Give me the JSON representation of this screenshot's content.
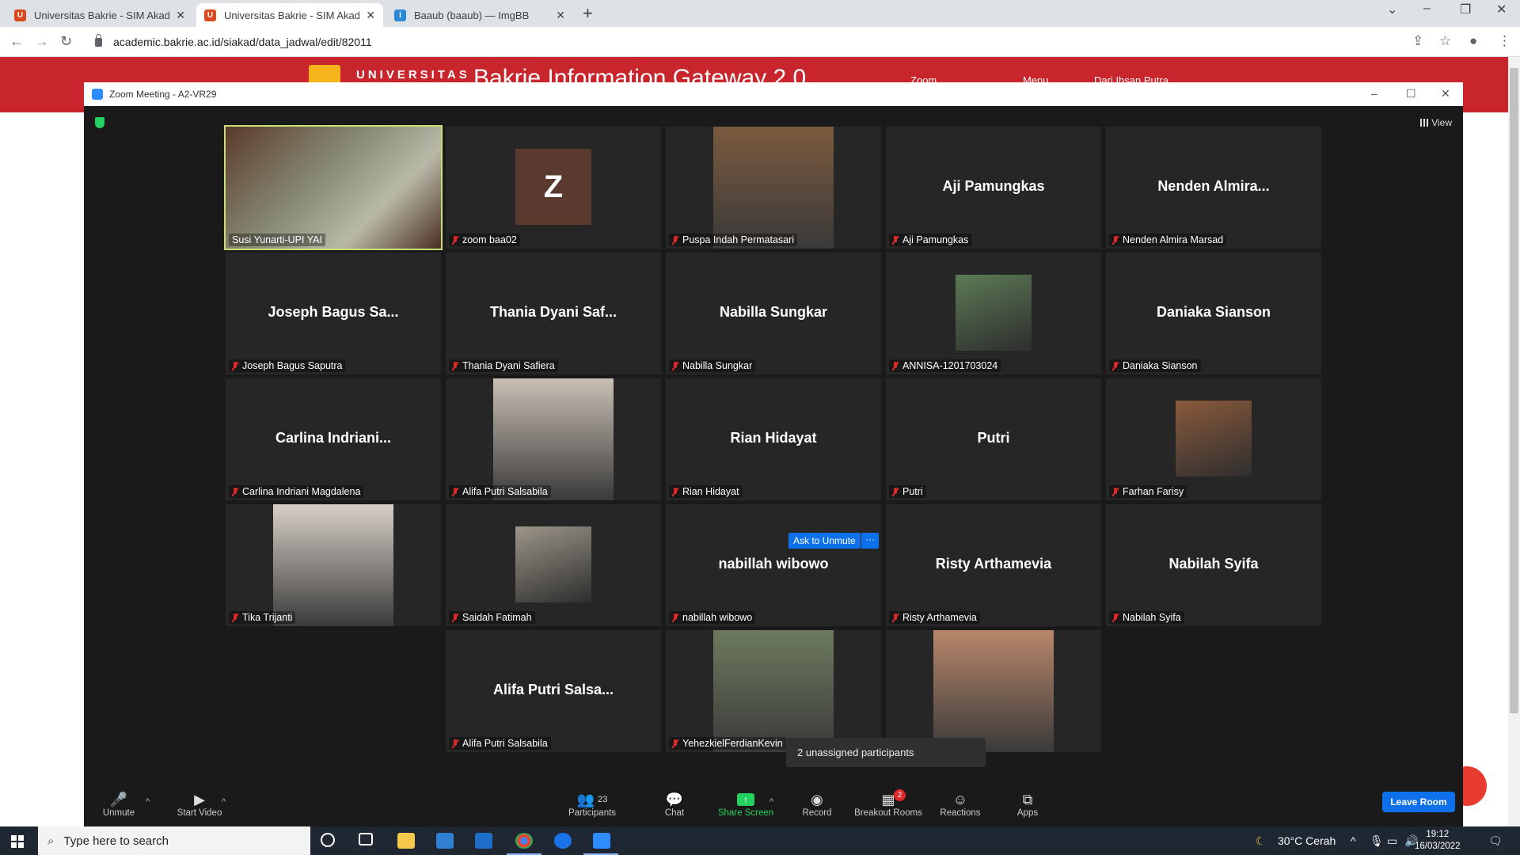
{
  "browser": {
    "tabs": [
      {
        "title": "Universitas Bakrie - SIM Akadem",
        "favicon": "ub"
      },
      {
        "title": "Universitas Bakrie - SIM Akadem",
        "favicon": "ub"
      },
      {
        "title": "Baaub (baaub) — ImgBB",
        "favicon": "ibb"
      }
    ],
    "url": "academic.bakrie.ac.id/siakad/data_jadwal/edit/82011"
  },
  "site": {
    "brand": "UNIVERSITAS",
    "title": "Bakrie Information Gateway 2.0",
    "nav": [
      "Zoom",
      "Menu",
      "Dari Ihsan Putra"
    ]
  },
  "zoom": {
    "window_title": "Zoom Meeting - A2-VR29",
    "view_label": "View",
    "participants": [
      {
        "name": "Susi Yunarti-UPI YAI",
        "display": "",
        "kind": "video",
        "active": true,
        "muted": false,
        "color": "#8a8f7a"
      },
      {
        "name": "zoom baa02",
        "display": "Z",
        "kind": "avatar",
        "muted": true
      },
      {
        "name": "Puspa Indah Permatasari",
        "display": "",
        "kind": "photo",
        "muted": true,
        "color": "#7b5a3d"
      },
      {
        "name": "Aji Pamungkas",
        "display": "Aji Pamungkas",
        "kind": "name",
        "muted": true
      },
      {
        "name": "Nenden Almira Marsad",
        "display": "Nenden Almira...",
        "kind": "name",
        "muted": true
      },
      {
        "name": "Joseph Bagus Saputra",
        "display": "Joseph Bagus Sa...",
        "kind": "name",
        "muted": true
      },
      {
        "name": "Thania Dyani Safiera",
        "display": "Thania Dyani Saf...",
        "kind": "name",
        "muted": true
      },
      {
        "name": "Nabilla Sungkar",
        "display": "Nabilla Sungkar",
        "kind": "name",
        "muted": true
      },
      {
        "name": "ANNISA-1201703024",
        "display": "",
        "kind": "smallphoto",
        "muted": true,
        "color": "#5c7a55"
      },
      {
        "name": "Daniaka Sianson",
        "display": "Daniaka Sianson",
        "kind": "name",
        "muted": true
      },
      {
        "name": "Carlina Indriani Magdalena",
        "display": "Carlina Indriani...",
        "kind": "name",
        "muted": true
      },
      {
        "name": "Alifa Putri Salsabila",
        "display": "",
        "kind": "photo",
        "muted": true,
        "color": "#c9bfb4"
      },
      {
        "name": "Rian Hidayat",
        "display": "Rian Hidayat",
        "kind": "name",
        "muted": true
      },
      {
        "name": "Putri",
        "display": "Putri",
        "kind": "name",
        "muted": true
      },
      {
        "name": "Farhan Farisy",
        "display": "",
        "kind": "smallphoto",
        "muted": true,
        "color": "#8a5a3c"
      },
      {
        "name": "Tika Trijanti",
        "display": "",
        "kind": "photo",
        "muted": true,
        "color": "#d8cfc8"
      },
      {
        "name": "Saidah Fatimah",
        "display": "",
        "kind": "smallphoto",
        "muted": true,
        "color": "#9c9589"
      },
      {
        "name": "nabillah wibowo",
        "display": "nabillah wibowo",
        "kind": "name",
        "muted": true
      },
      {
        "name": "Risty Arthamevia",
        "display": "Risty Arthamevia",
        "kind": "name",
        "muted": true
      },
      {
        "name": "Nabilah Syifa",
        "display": "Nabilah Syifa",
        "kind": "name",
        "muted": true
      },
      {
        "name": "Alifa Putri Salsabila",
        "display": "Alifa Putri Salsa...",
        "kind": "name",
        "muted": true
      },
      {
        "name": "YehezkielFerdianKevin",
        "display": "",
        "kind": "photo",
        "muted": true,
        "color": "#6d7a5e"
      },
      {
        "name": "",
        "display": "",
        "kind": "photo",
        "muted": false,
        "color": "#b8876a"
      }
    ],
    "ask_to_unmute": "Ask to Unmute",
    "more_label": "···",
    "toast": "2 unassigned participants",
    "toolbar": {
      "unmute": "Unmute",
      "start_video": "Start Video",
      "participants": "Participants",
      "participants_count": "23",
      "chat": "Chat",
      "share_screen": "Share Screen",
      "record": "Record",
      "breakout_rooms": "Breakout Rooms",
      "breakout_badge": "2",
      "reactions": "Reactions",
      "apps": "Apps",
      "leave": "Leave Room"
    }
  },
  "taskbar": {
    "search_placeholder": "Type here to search",
    "weather": "30°C  Cerah",
    "time": "19:12",
    "date": "16/03/2022"
  },
  "colors": {
    "zoom_blue": "#0e71eb",
    "active_speaker": "#c8e06b",
    "share_green": "#23d160",
    "site_red": "#c8252c"
  }
}
